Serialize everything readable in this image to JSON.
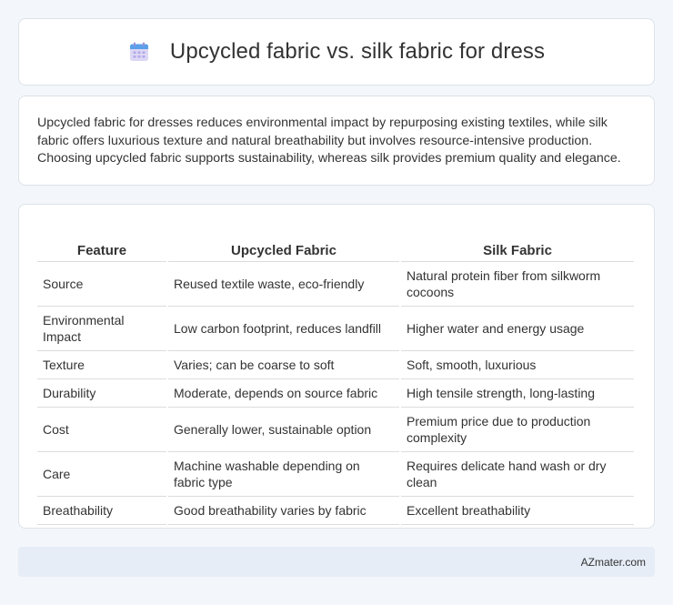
{
  "header": {
    "icon": "calendar-icon",
    "title": "Upcycled fabric vs. silk fabric for dress"
  },
  "description": "Upcycled fabric for dresses reduces environmental impact by repurposing existing textiles, while silk fabric offers luxurious texture and natural breathability but involves resource-intensive production. Choosing upcycled fabric supports sustainability, whereas silk provides premium quality and elegance.",
  "table": {
    "headers": [
      "Feature",
      "Upcycled Fabric",
      "Silk Fabric"
    ],
    "rows": [
      [
        "Source",
        "Reused textile waste, eco-friendly",
        "Natural protein fiber from silkworm cocoons"
      ],
      [
        "Environmental Impact",
        "Low carbon footprint, reduces landfill",
        "Higher water and energy usage"
      ],
      [
        "Texture",
        "Varies; can be coarse to soft",
        "Soft, smooth, luxurious"
      ],
      [
        "Durability",
        "Moderate, depends on source fabric",
        "High tensile strength, long-lasting"
      ],
      [
        "Cost",
        "Generally lower, sustainable option",
        "Premium price due to production complexity"
      ],
      [
        "Care",
        "Machine washable depending on fabric type",
        "Requires delicate hand wash or dry clean"
      ],
      [
        "Breathability",
        "Good breathability varies by fabric",
        "Excellent breathability"
      ]
    ]
  },
  "footer": {
    "site": "AZmater.com"
  },
  "colors": {
    "page_background": "#f3f6fa",
    "card_background": "#ffffff",
    "footer_background": "#e6edf7"
  }
}
